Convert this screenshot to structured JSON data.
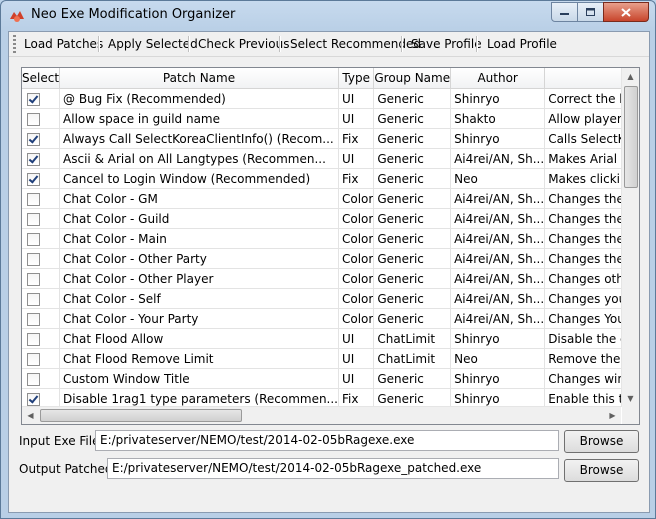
{
  "window": {
    "title": "Neo Exe Modification Organizer"
  },
  "toolbar": {
    "load_patches": "Load Patches",
    "apply_selected": "Apply Selected",
    "check_previous": "Check Previous",
    "select_recommended": "Select Recommended",
    "save_profile": "Save Profile",
    "load_profile": "Load Profile"
  },
  "table": {
    "columns": [
      "Select",
      "Patch Name",
      "Type",
      "Group Name",
      "Author",
      ""
    ],
    "rows": [
      {
        "checked": true,
        "name": "@ Bug Fix (Recommended)",
        "type": "UI",
        "group": "Generic",
        "author": "Shinryo",
        "desc": "Correct the b"
      },
      {
        "checked": false,
        "name": "Allow space in guild name",
        "type": "UI",
        "group": "Generic",
        "author": "Shakto",
        "desc": "Allow player"
      },
      {
        "checked": true,
        "name": "Always Call SelectKoreaClientInfo() (Recom...",
        "type": "Fix",
        "group": "Generic",
        "author": "Shinryo",
        "desc": "Calls SelectK"
      },
      {
        "checked": true,
        "name": "Ascii & Arial on All Langtypes (Recommen...",
        "type": "UI",
        "group": "Generic",
        "author": "Ai4rei/AN, Sh...",
        "desc": "Makes Arial t"
      },
      {
        "checked": true,
        "name": "Cancel to Login Window (Recommended)",
        "type": "Fix",
        "group": "Generic",
        "author": "Neo",
        "desc": "Makes clickin"
      },
      {
        "checked": false,
        "name": "Chat Color - GM",
        "type": "Color",
        "group": "Generic",
        "author": "Ai4rei/AN, Sh...",
        "desc": "Changes the"
      },
      {
        "checked": false,
        "name": "Chat Color - Guild",
        "type": "Color",
        "group": "Generic",
        "author": "Ai4rei/AN, Sh...",
        "desc": "Changes the"
      },
      {
        "checked": false,
        "name": "Chat Color - Main",
        "type": "Color",
        "group": "Generic",
        "author": "Ai4rei/AN, Sh...",
        "desc": "Changes the"
      },
      {
        "checked": false,
        "name": "Chat Color - Other Party",
        "type": "Color",
        "group": "Generic",
        "author": "Ai4rei/AN, Sh...",
        "desc": "Changes the"
      },
      {
        "checked": false,
        "name": "Chat Color - Other Player",
        "type": "Color",
        "group": "Generic",
        "author": "Ai4rei/AN, Sh...",
        "desc": "Changes oth"
      },
      {
        "checked": false,
        "name": "Chat Color - Self",
        "type": "Color",
        "group": "Generic",
        "author": "Ai4rei/AN, Sh...",
        "desc": "Changes you"
      },
      {
        "checked": false,
        "name": "Chat Color - Your Party",
        "type": "Color",
        "group": "Generic",
        "author": "Ai4rei/AN, Sh...",
        "desc": "Changes You"
      },
      {
        "checked": false,
        "name": "Chat Flood Allow",
        "type": "UI",
        "group": "ChatLimit",
        "author": "Shinryo",
        "desc": "Disable the c"
      },
      {
        "checked": false,
        "name": "Chat Flood Remove Limit",
        "type": "UI",
        "group": "ChatLimit",
        "author": "Neo",
        "desc": "Remove the"
      },
      {
        "checked": false,
        "name": "Custom Window Title",
        "type": "UI",
        "group": "Generic",
        "author": "Shinryo",
        "desc": "Changes win"
      },
      {
        "checked": true,
        "name": "Disable 1rag1 type parameters (Recommen...",
        "type": "Fix",
        "group": "Generic",
        "author": "Shinryo",
        "desc": "Enable this to"
      }
    ]
  },
  "input_exe": {
    "label": "Input Exe File:",
    "value": "E:/privateserver/NEMO/test/2014-02-05bRagexe.exe",
    "browse": "Browse"
  },
  "output_patched": {
    "label": "Output Patched :",
    "value": "E:/privateserver/NEMO/test/2014-02-05bRagexe_patched.exe",
    "browse": "Browse"
  },
  "colors": {
    "title_bar": "#bcd3ea",
    "close_button": "#c8452c",
    "check_mark": "#1f3f7a"
  }
}
